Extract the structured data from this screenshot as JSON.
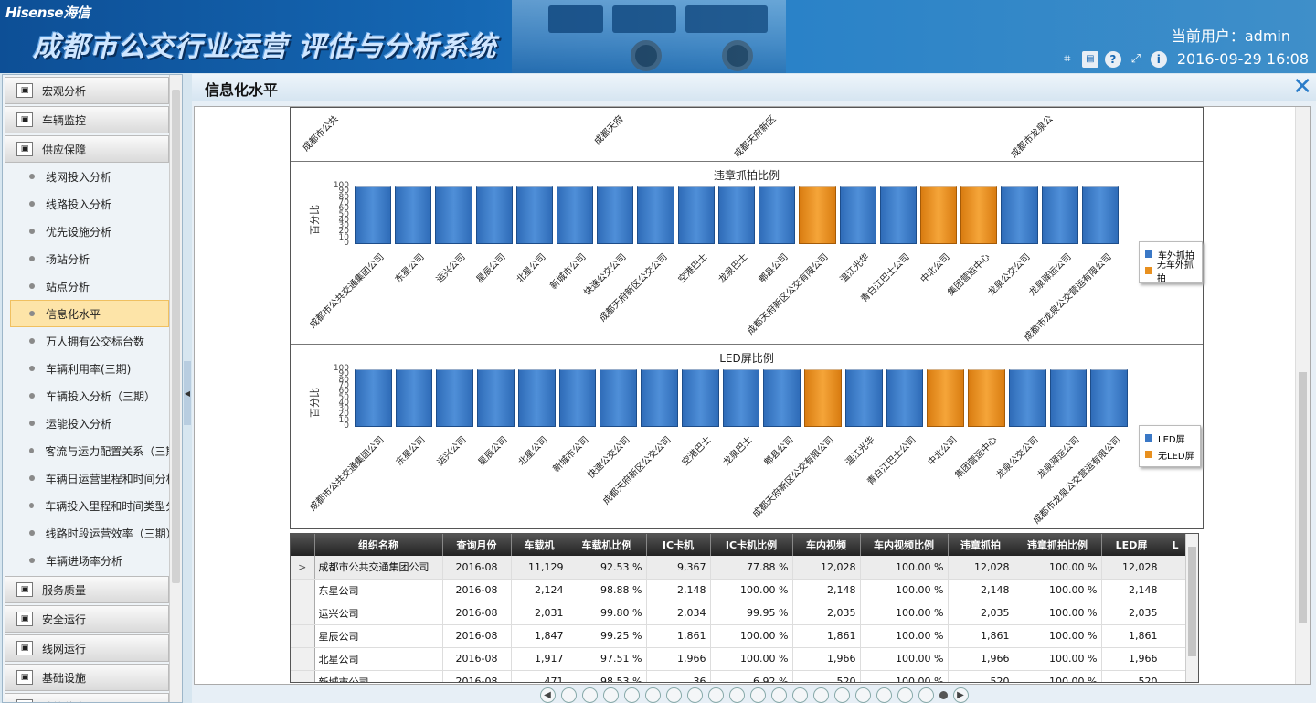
{
  "header": {
    "brand": "Hisense海信",
    "title": "成都市公交行业运营 评估与分析系统",
    "user_label": "当前用户：admin",
    "datetime": "2016-09-29 16:08"
  },
  "sidebar": {
    "groups_top": [
      {
        "label": "宏观分析",
        "icon": "chart-icon"
      },
      {
        "label": "车辆监控",
        "icon": "camera-icon"
      },
      {
        "label": "供应保障",
        "icon": "supply-icon"
      }
    ],
    "items": [
      "线网投入分析",
      "线路投入分析",
      "优先设施分析",
      "场站分析",
      "站点分析",
      "信息化水平",
      "万人拥有公交标台数",
      "车辆利用率(三期)",
      "车辆投入分析（三期）",
      "运能投入分析",
      "客流与运力配置关系（三期）",
      "车辆日运营里程和时间分析",
      "车辆投入里程和时间类型分析",
      "线路时段运营效率（三期）",
      "车辆进场率分析"
    ],
    "active_index": 5,
    "groups_bottom": [
      {
        "label": "服务质量",
        "icon": "service-icon"
      },
      {
        "label": "安全运行",
        "icon": "safety-icon"
      },
      {
        "label": "线网运行",
        "icon": "network-icon"
      },
      {
        "label": "基础设施",
        "icon": "infrastructure-icon"
      },
      {
        "label": "政策体惠",
        "icon": "policy-icon"
      }
    ]
  },
  "panel": {
    "title": "信息化水平"
  },
  "top_chart_labels": [
    "成都市公共",
    "成都天府",
    "成都天府新区",
    "成都市龙泉公"
  ],
  "chart_data": [
    {
      "type": "bar",
      "title": "违章抓拍比例",
      "ylabel": "百分比",
      "ylim": [
        0,
        100
      ],
      "yticks": [
        0,
        10,
        20,
        30,
        40,
        50,
        60,
        70,
        80,
        90,
        100
      ],
      "categories": [
        "成都市公共交通集团公司",
        "东星公司",
        "运兴公司",
        "星辰公司",
        "北星公司",
        "新城市公司",
        "快速公交公司",
        "成都天府新区公交公司",
        "空港巴士",
        "龙泉巴士",
        "郫县公司",
        "成都天府新区公交有限公司",
        "温江光华",
        "青白江巴士公司",
        "中北公司",
        "集团营运中心",
        "龙泉公交公司",
        "龙泉驿运公司",
        "成都市龙泉公交营运有限公司"
      ],
      "series": [
        {
          "name": "车外抓拍",
          "color": "#3a78c6",
          "values": [
            100,
            100,
            100,
            100,
            100,
            100,
            100,
            100,
            100,
            100,
            100,
            0,
            100,
            100,
            0,
            0,
            100,
            100,
            100
          ]
        },
        {
          "name": "无车外抓拍",
          "color": "#e8901f",
          "values": [
            0,
            0,
            0,
            0,
            0,
            0,
            0,
            0,
            0,
            0,
            0,
            100,
            0,
            0,
            100,
            100,
            0,
            0,
            0
          ]
        }
      ],
      "legend": "right"
    },
    {
      "type": "bar",
      "title": "LED屏比例",
      "ylabel": "百分比",
      "ylim": [
        0,
        100
      ],
      "yticks": [
        0,
        10,
        20,
        30,
        40,
        50,
        60,
        70,
        80,
        90,
        100
      ],
      "categories": [
        "成都市公共交通集团公司",
        "东星公司",
        "运兴公司",
        "星辰公司",
        "北星公司",
        "新城市公司",
        "快速公交公司",
        "成都天府新区公交公司",
        "空港巴士",
        "龙泉巴士",
        "郫县公司",
        "成都天府新区公交有限公司",
        "温江光华",
        "青白江巴士公司",
        "中北公司",
        "集团营运中心",
        "龙泉公交公司",
        "龙泉驿运公司",
        "成都市龙泉公交营运有限公司"
      ],
      "series": [
        {
          "name": "LED屏",
          "color": "#3a78c6",
          "values": [
            100,
            100,
            100,
            100,
            100,
            100,
            100,
            100,
            100,
            100,
            100,
            0,
            100,
            100,
            0,
            0,
            100,
            100,
            100
          ]
        },
        {
          "name": "无LED屏",
          "color": "#e8901f",
          "values": [
            0,
            0,
            0,
            0,
            0,
            0,
            0,
            0,
            0,
            0,
            0,
            100,
            0,
            0,
            100,
            100,
            0,
            0,
            0
          ]
        }
      ],
      "legend": "right"
    }
  ],
  "table": {
    "columns": [
      "组织名称",
      "查询月份",
      "车载机",
      "车载机比例",
      "IC卡机",
      "IC卡机比例",
      "车内视频",
      "车内视频比例",
      "违章抓拍",
      "违章抓拍比例",
      "LED屏",
      "L"
    ],
    "rows": [
      [
        "成都市公共交通集团公司",
        "2016-08",
        "11,129",
        "92.53 %",
        "9,367",
        "77.88 %",
        "12,028",
        "100.00 %",
        "12,028",
        "100.00 %",
        "12,028",
        ""
      ],
      [
        "东星公司",
        "2016-08",
        "2,124",
        "98.88 %",
        "2,148",
        "100.00 %",
        "2,148",
        "100.00 %",
        "2,148",
        "100.00 %",
        "2,148",
        ""
      ],
      [
        "运兴公司",
        "2016-08",
        "2,031",
        "99.80 %",
        "2,034",
        "99.95 %",
        "2,035",
        "100.00 %",
        "2,035",
        "100.00 %",
        "2,035",
        ""
      ],
      [
        "星辰公司",
        "2016-08",
        "1,847",
        "99.25 %",
        "1,861",
        "100.00 %",
        "1,861",
        "100.00 %",
        "1,861",
        "100.00 %",
        "1,861",
        ""
      ],
      [
        "北星公司",
        "2016-08",
        "1,917",
        "97.51 %",
        "1,966",
        "100.00 %",
        "1,966",
        "100.00 %",
        "1,966",
        "100.00 %",
        "1,966",
        ""
      ],
      [
        "新城市公司",
        "2016-08",
        "471",
        "98.53 %",
        "36",
        "6.92 %",
        "520",
        "100.00 %",
        "520",
        "100.00 %",
        "520",
        ""
      ]
    ],
    "selected_row": 0,
    "row_indicator": ">"
  },
  "pager": {
    "pages": 19,
    "current": 19,
    "prev": "◀",
    "next": "▶"
  }
}
